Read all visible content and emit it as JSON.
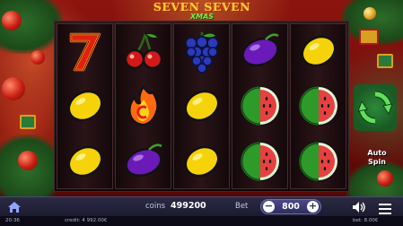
{
  "logo": {
    "title": "SEVEN SEVEN",
    "subtitle": "XMAS"
  },
  "reels": [
    [
      "seven",
      "lemon",
      "lemon"
    ],
    [
      "cherry",
      "fire",
      "plum"
    ],
    [
      "grape",
      "lemon",
      "lemon"
    ],
    [
      "plum",
      "watermelon",
      "watermelon"
    ],
    [
      "lemon",
      "watermelon",
      "watermelon"
    ]
  ],
  "controls": {
    "auto_spin_line1": "Auto",
    "auto_spin_line2": "Spin"
  },
  "bottom": {
    "coins_label": "coins",
    "coins_value": "499200",
    "bet_label": "Bet",
    "bet_value": "800",
    "bet_minus": "−",
    "bet_plus": "+"
  },
  "status": {
    "time": "20:36",
    "credit": "credit: 4 992.00€",
    "bet": "bet: 8.00€"
  },
  "colors": {
    "background": "#7a0d0b",
    "bar": "#2b2a44",
    "accent_green": "#2c8a3a",
    "logo_gold": "#ffd23c"
  },
  "icons": [
    "home-icon",
    "minus-icon",
    "plus-icon",
    "speaker-icon",
    "menu-icon",
    "spin-arrows-icon"
  ]
}
